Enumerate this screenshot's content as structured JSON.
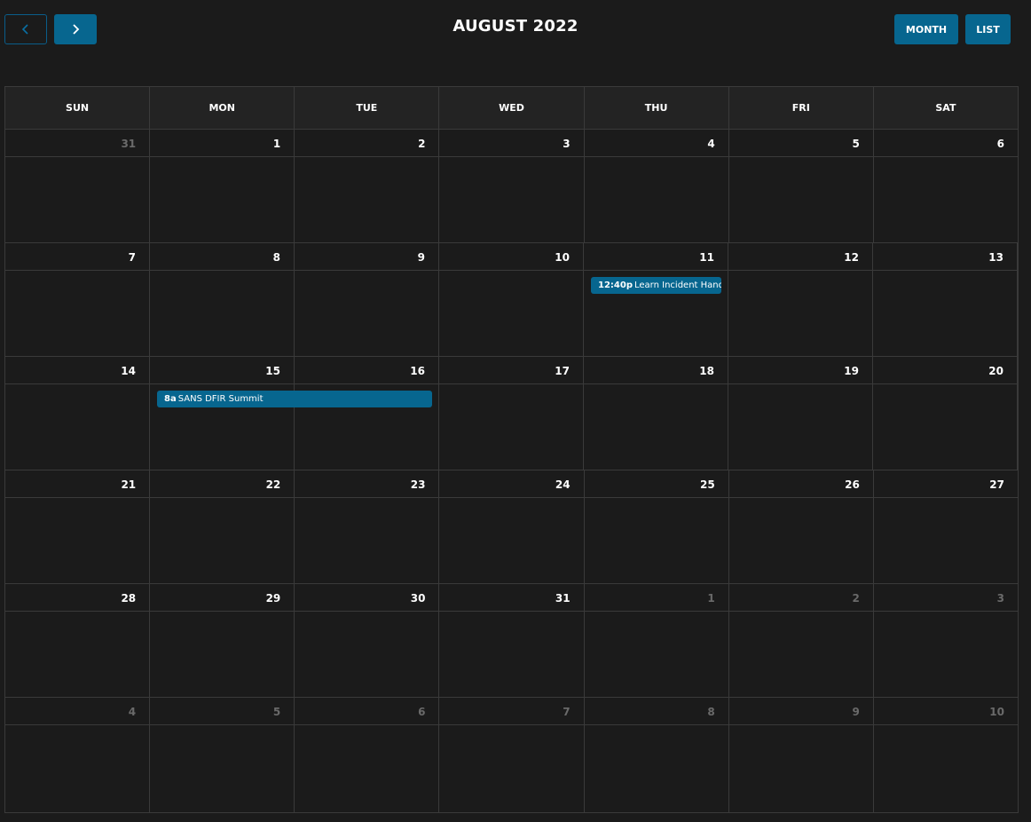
{
  "header": {
    "title": "AUGUST 2022",
    "prev_icon": "chevron-left-icon",
    "next_icon": "chevron-right-icon",
    "views": [
      {
        "label": "MONTH"
      },
      {
        "label": "LIST"
      }
    ]
  },
  "colors": {
    "accent": "#07668f",
    "background": "#1b1b1b",
    "grid": "#3a3a3a"
  },
  "weekdays": [
    "SUN",
    "MON",
    "TUE",
    "WED",
    "THU",
    "FRI",
    "SAT"
  ],
  "weeks": [
    [
      {
        "n": "31",
        "o": true
      },
      {
        "n": "1"
      },
      {
        "n": "2"
      },
      {
        "n": "3"
      },
      {
        "n": "4"
      },
      {
        "n": "5"
      },
      {
        "n": "6"
      }
    ],
    [
      {
        "n": "7"
      },
      {
        "n": "8"
      },
      {
        "n": "9"
      },
      {
        "n": "10"
      },
      {
        "n": "11"
      },
      {
        "n": "12"
      },
      {
        "n": "13"
      }
    ],
    [
      {
        "n": "14"
      },
      {
        "n": "15"
      },
      {
        "n": "16"
      },
      {
        "n": "17"
      },
      {
        "n": "18"
      },
      {
        "n": "19"
      },
      {
        "n": "20"
      }
    ],
    [
      {
        "n": "21"
      },
      {
        "n": "22"
      },
      {
        "n": "23"
      },
      {
        "n": "24"
      },
      {
        "n": "25"
      },
      {
        "n": "26"
      },
      {
        "n": "27"
      }
    ],
    [
      {
        "n": "28"
      },
      {
        "n": "29"
      },
      {
        "n": "30"
      },
      {
        "n": "31"
      },
      {
        "n": "1",
        "o": true
      },
      {
        "n": "2",
        "o": true
      },
      {
        "n": "3",
        "o": true
      }
    ],
    [
      {
        "n": "4",
        "o": true
      },
      {
        "n": "5",
        "o": true
      },
      {
        "n": "6",
        "o": true
      },
      {
        "n": "7",
        "o": true
      },
      {
        "n": "8",
        "o": true
      },
      {
        "n": "9",
        "o": true
      },
      {
        "n": "10",
        "o": true
      }
    ]
  ],
  "events": [
    {
      "week": 1,
      "day": 4,
      "span": 1,
      "time": "12:40p",
      "title": "Learn Incident Handling"
    },
    {
      "week": 2,
      "day": 1,
      "span": 2,
      "time": "8a",
      "title": "SANS DFIR Summit"
    }
  ]
}
